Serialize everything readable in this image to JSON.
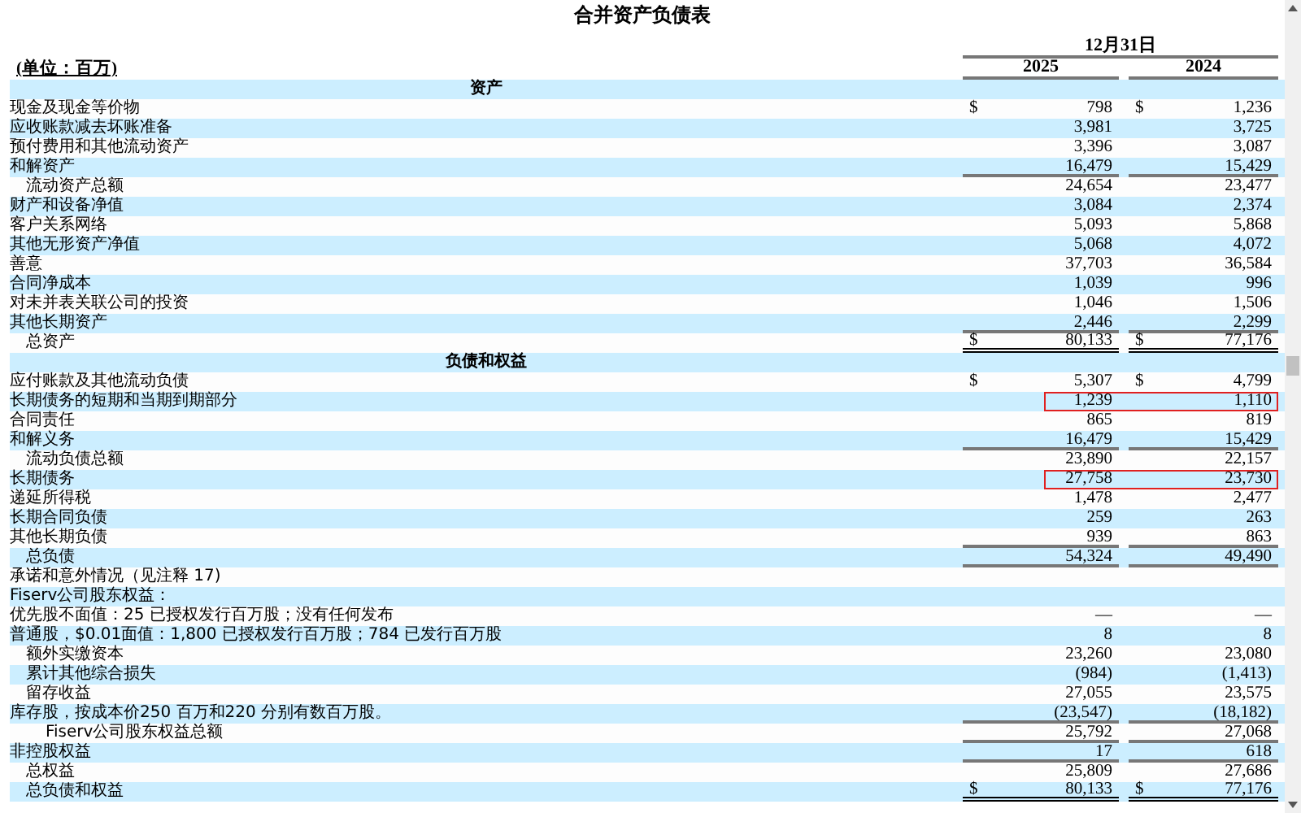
{
  "title": "合并资产负债表",
  "unit": "(单位：百万)",
  "period": "12月31日",
  "columns": [
    "2025",
    "2024"
  ],
  "rows": [
    {
      "kind": "section",
      "label": "资产",
      "highlighted": false,
      "values": []
    },
    {
      "kind": "line",
      "label": "现金及现金等价物",
      "highlighted": false,
      "values": [
        {
          "currency": "$",
          "amount": "798"
        },
        {
          "currency": "$",
          "amount": "1,236"
        }
      ]
    },
    {
      "kind": "line",
      "label": "应收账款减去坏账准备",
      "highlighted": false,
      "values": [
        {
          "amount": "3,981"
        },
        {
          "amount": "3,725"
        }
      ]
    },
    {
      "kind": "line",
      "label": "预付费用和其他流动资产",
      "highlighted": false,
      "values": [
        {
          "amount": "3,396"
        },
        {
          "amount": "3,087"
        }
      ]
    },
    {
      "kind": "line",
      "label": "和解资产",
      "highlighted": false,
      "underlined": true,
      "values": [
        {
          "amount": "16,479"
        },
        {
          "amount": "15,429"
        }
      ]
    },
    {
      "kind": "sub",
      "label": "流动资产总额",
      "highlighted": false,
      "values": [
        {
          "amount": "24,654"
        },
        {
          "amount": "23,477"
        }
      ]
    },
    {
      "kind": "line",
      "label": "财产和设备净值",
      "highlighted": false,
      "values": [
        {
          "amount": "3,084"
        },
        {
          "amount": "2,374"
        }
      ]
    },
    {
      "kind": "line",
      "label": "客户关系网络",
      "highlighted": false,
      "values": [
        {
          "amount": "5,093"
        },
        {
          "amount": "5,868"
        }
      ]
    },
    {
      "kind": "line",
      "label": "其他无形资产净值",
      "highlighted": false,
      "values": [
        {
          "amount": "5,068"
        },
        {
          "amount": "4,072"
        }
      ]
    },
    {
      "kind": "line",
      "label": "善意",
      "highlighted": false,
      "values": [
        {
          "amount": "37,703"
        },
        {
          "amount": "36,584"
        }
      ]
    },
    {
      "kind": "line",
      "label": "合同净成本",
      "highlighted": false,
      "values": [
        {
          "amount": "1,039"
        },
        {
          "amount": "996"
        }
      ]
    },
    {
      "kind": "line",
      "label": "对未并表关联公司的投资",
      "highlighted": false,
      "values": [
        {
          "amount": "1,046"
        },
        {
          "amount": "1,506"
        }
      ]
    },
    {
      "kind": "line",
      "label": "其他长期资产",
      "highlighted": false,
      "underlined": true,
      "values": [
        {
          "amount": "2,446"
        },
        {
          "amount": "2,299"
        }
      ]
    },
    {
      "kind": "sub",
      "label": "总资产",
      "highlighted": false,
      "double_underlined": true,
      "values": [
        {
          "currency": "$",
          "amount": "80,133"
        },
        {
          "currency": "$",
          "amount": "77,176"
        }
      ]
    },
    {
      "kind": "section",
      "label": "负债和权益",
      "highlighted": false,
      "values": []
    },
    {
      "kind": "line",
      "label": "应付账款及其他流动负债",
      "highlighted": false,
      "values": [
        {
          "currency": "$",
          "amount": "5,307"
        },
        {
          "currency": "$",
          "amount": "4,799"
        }
      ]
    },
    {
      "kind": "line",
      "label": "长期债务的短期和当期到期部分",
      "highlighted": true,
      "values": [
        {
          "amount": "1,239"
        },
        {
          "amount": "1,110"
        }
      ]
    },
    {
      "kind": "line",
      "label": "合同责任",
      "highlighted": false,
      "values": [
        {
          "amount": "865"
        },
        {
          "amount": "819"
        }
      ]
    },
    {
      "kind": "line",
      "label": "和解义务",
      "highlighted": false,
      "underlined": true,
      "values": [
        {
          "amount": "16,479"
        },
        {
          "amount": "15,429"
        }
      ]
    },
    {
      "kind": "sub",
      "label": "流动负债总额",
      "highlighted": false,
      "values": [
        {
          "amount": "23,890"
        },
        {
          "amount": "22,157"
        }
      ]
    },
    {
      "kind": "line",
      "label": "长期债务",
      "highlighted": true,
      "values": [
        {
          "amount": "27,758"
        },
        {
          "amount": "23,730"
        }
      ]
    },
    {
      "kind": "line",
      "label": "递延所得税",
      "highlighted": false,
      "values": [
        {
          "amount": "1,478"
        },
        {
          "amount": "2,477"
        }
      ]
    },
    {
      "kind": "line",
      "label": "长期合同负债",
      "highlighted": false,
      "values": [
        {
          "amount": "259"
        },
        {
          "amount": "263"
        }
      ]
    },
    {
      "kind": "line",
      "label": "其他长期负债",
      "highlighted": false,
      "underlined": true,
      "values": [
        {
          "amount": "939"
        },
        {
          "amount": "863"
        }
      ]
    },
    {
      "kind": "sub",
      "label": "总负债",
      "highlighted": false,
      "underlined": true,
      "values": [
        {
          "amount": "54,324"
        },
        {
          "amount": "49,490"
        }
      ]
    },
    {
      "kind": "line",
      "label": "承诺和意外情况（见注释 17)",
      "highlighted": false,
      "values": []
    },
    {
      "kind": "line",
      "label": "Fiserv公司股东权益：",
      "highlighted": false,
      "values": []
    },
    {
      "kind": "line",
      "label": "优先股不面值：25 已授权发行百万股；没有任何发布",
      "highlighted": false,
      "values": [
        {
          "amount": "—"
        },
        {
          "amount": "—"
        }
      ]
    },
    {
      "kind": "line",
      "label": "普通股，$0.01面值：1,800 已授权发行百万股；784 已发行百万股",
      "highlighted": false,
      "values": [
        {
          "amount": "8"
        },
        {
          "amount": "8"
        }
      ]
    },
    {
      "kind": "sub",
      "label": "额外实缴资本",
      "highlighted": false,
      "values": [
        {
          "amount": "23,260"
        },
        {
          "amount": "23,080"
        }
      ]
    },
    {
      "kind": "sub",
      "label": "累计其他综合损失",
      "highlighted": false,
      "values": [
        {
          "amount": "(984)"
        },
        {
          "amount": "(1,413)"
        }
      ]
    },
    {
      "kind": "sub",
      "label": "留存收益",
      "highlighted": false,
      "values": [
        {
          "amount": "27,055"
        },
        {
          "amount": "23,575"
        }
      ]
    },
    {
      "kind": "line",
      "label": "库存股，按成本价250 百万和220 分别有数百万股。",
      "highlighted": false,
      "underlined": true,
      "values": [
        {
          "amount": "(23,547)"
        },
        {
          "amount": "(18,182)"
        }
      ]
    },
    {
      "kind": "subsub",
      "label": "Fiserv公司股东权益总额",
      "highlighted": false,
      "underlined": true,
      "values": [
        {
          "amount": "25,792"
        },
        {
          "amount": "27,068"
        }
      ]
    },
    {
      "kind": "line",
      "label": "非控股权益",
      "highlighted": false,
      "underlined": true,
      "values": [
        {
          "amount": "17"
        },
        {
          "amount": "618"
        }
      ]
    },
    {
      "kind": "sub",
      "label": "总权益",
      "highlighted": false,
      "values": [
        {
          "amount": "25,809"
        },
        {
          "amount": "27,686"
        }
      ]
    },
    {
      "kind": "sub",
      "label": "总负债和权益",
      "highlighted": false,
      "double_underlined": true,
      "values": [
        {
          "currency": "$",
          "amount": "80,133"
        },
        {
          "currency": "$",
          "amount": "77,176"
        }
      ]
    }
  ]
}
